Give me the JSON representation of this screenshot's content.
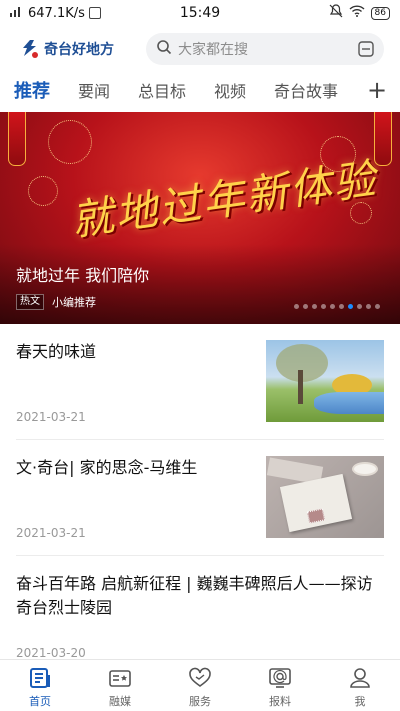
{
  "status_bar": {
    "network_speed": "647.1K/s",
    "time": "15:49",
    "battery": "86"
  },
  "header": {
    "app_name": "奇台好地方",
    "search_placeholder": "大家都在搜"
  },
  "tabs": [
    {
      "label": "推荐",
      "active": true
    },
    {
      "label": "要闻",
      "active": false
    },
    {
      "label": "总目标",
      "active": false
    },
    {
      "label": "视频",
      "active": false
    },
    {
      "label": "奇台故事",
      "active": false
    }
  ],
  "tab_add_label": "+",
  "banner": {
    "art_text": "就地过年新体验",
    "title": "就地过年  我们陪你",
    "tag": "热文",
    "source": "小编推荐",
    "dot_count": 10,
    "active_dot": 6
  },
  "news": [
    {
      "title": "春天的味道",
      "date": "2021-03-21",
      "thumb": "spring"
    },
    {
      "title": "文·奇台| 家的思念-马维生",
      "date": "2021-03-21",
      "thumb": "letter"
    },
    {
      "title": "奋斗百年路 启航新征程 | 巍巍丰碑照后人——探访奇台烈士陵园",
      "date": "2021-03-20",
      "thumb": null
    }
  ],
  "bottom_nav": [
    {
      "label": "首页",
      "icon": "home-icon",
      "active": true
    },
    {
      "label": "融媒",
      "icon": "media-icon",
      "active": false
    },
    {
      "label": "服务",
      "icon": "service-heart-icon",
      "active": false
    },
    {
      "label": "报料",
      "icon": "report-icon",
      "active": false
    },
    {
      "label": "我",
      "icon": "profile-icon",
      "active": false
    }
  ],
  "colors": {
    "accent": "#1a5cb8",
    "text": "#111111",
    "muted": "#999999"
  }
}
